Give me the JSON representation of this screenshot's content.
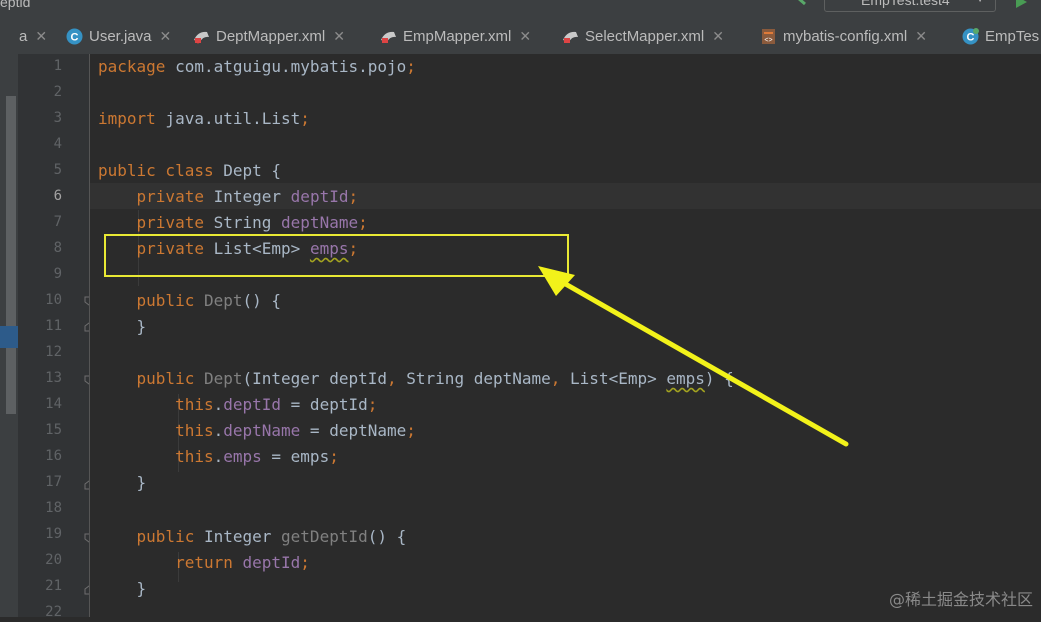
{
  "topbar": {
    "breadcrumb": "eptid",
    "run_config": "EmpTest.test4"
  },
  "tabs": [
    {
      "label": "a",
      "icon": "java-file-icon",
      "closable": true
    },
    {
      "label": "User.java",
      "icon": "class-icon",
      "closable": true
    },
    {
      "label": "DeptMapper.xml",
      "icon": "mybatis-xml-icon",
      "closable": true
    },
    {
      "label": "EmpMapper.xml",
      "icon": "mybatis-xml-icon",
      "closable": true
    },
    {
      "label": "SelectMapper.xml",
      "icon": "mybatis-xml-icon",
      "closable": true
    },
    {
      "label": "mybatis-config.xml",
      "icon": "xml-config-icon",
      "closable": true
    },
    {
      "label": "EmpTes",
      "icon": "test-class-icon",
      "closable": false
    }
  ],
  "editor": {
    "line_numbers": [
      "1",
      "2",
      "3",
      "4",
      "5",
      "6",
      "7",
      "8",
      "9",
      "10",
      "11",
      "12",
      "13",
      "14",
      "15",
      "16",
      "17",
      "18",
      "19",
      "20",
      "21",
      "22"
    ],
    "active_line": "6",
    "code": {
      "l1": {
        "kw": "package",
        "rest": " com.atguigu.mybatis.pojo",
        "semi": ";"
      },
      "l3": {
        "kw": "import",
        "rest": " java.util.List",
        "semi": ";"
      },
      "l5": {
        "kw": "public class",
        "rest": " Dept {"
      },
      "l6": {
        "kw": "private",
        "type": " Integer ",
        "field": "deptId",
        "semi": ";"
      },
      "l7": {
        "kw": "private",
        "type": " String ",
        "field": "deptName",
        "semi": ";"
      },
      "l8": {
        "kw": "private",
        "type": " List<Emp> ",
        "field": "emps",
        "semi": ";"
      },
      "l10": {
        "kw": "public",
        "name": " Dept",
        "rest": "() {"
      },
      "l11": {
        "rest": "}"
      },
      "l13": {
        "kw": "public",
        "name": " Dept",
        "p1": "(Integer deptId",
        "c1": ",",
        "p2": " String deptName",
        "c2": ",",
        "p3": " List<Emp> ",
        "p3w": "emps",
        "p4": ") {"
      },
      "l14": {
        "kw": "this",
        "dot": ".",
        "field": "deptId",
        "rest": " = deptId",
        "semi": ";"
      },
      "l15": {
        "kw": "this",
        "dot": ".",
        "field": "deptName",
        "rest": " = deptName",
        "semi": ";"
      },
      "l16": {
        "kw": "this",
        "dot": ".",
        "field": "emps",
        "rest": " = emps",
        "semi": ";"
      },
      "l17": {
        "rest": "}"
      },
      "l19": {
        "kw": "public",
        "type": " Integer ",
        "name": "getDeptId",
        "rest": "() {"
      },
      "l20": {
        "kw": "return",
        "field": " deptId",
        "semi": ";"
      },
      "l21": {
        "rest": "}"
      }
    }
  },
  "annotation": {
    "color": "#e9e934"
  },
  "watermark": "@稀土掘金技术社区"
}
